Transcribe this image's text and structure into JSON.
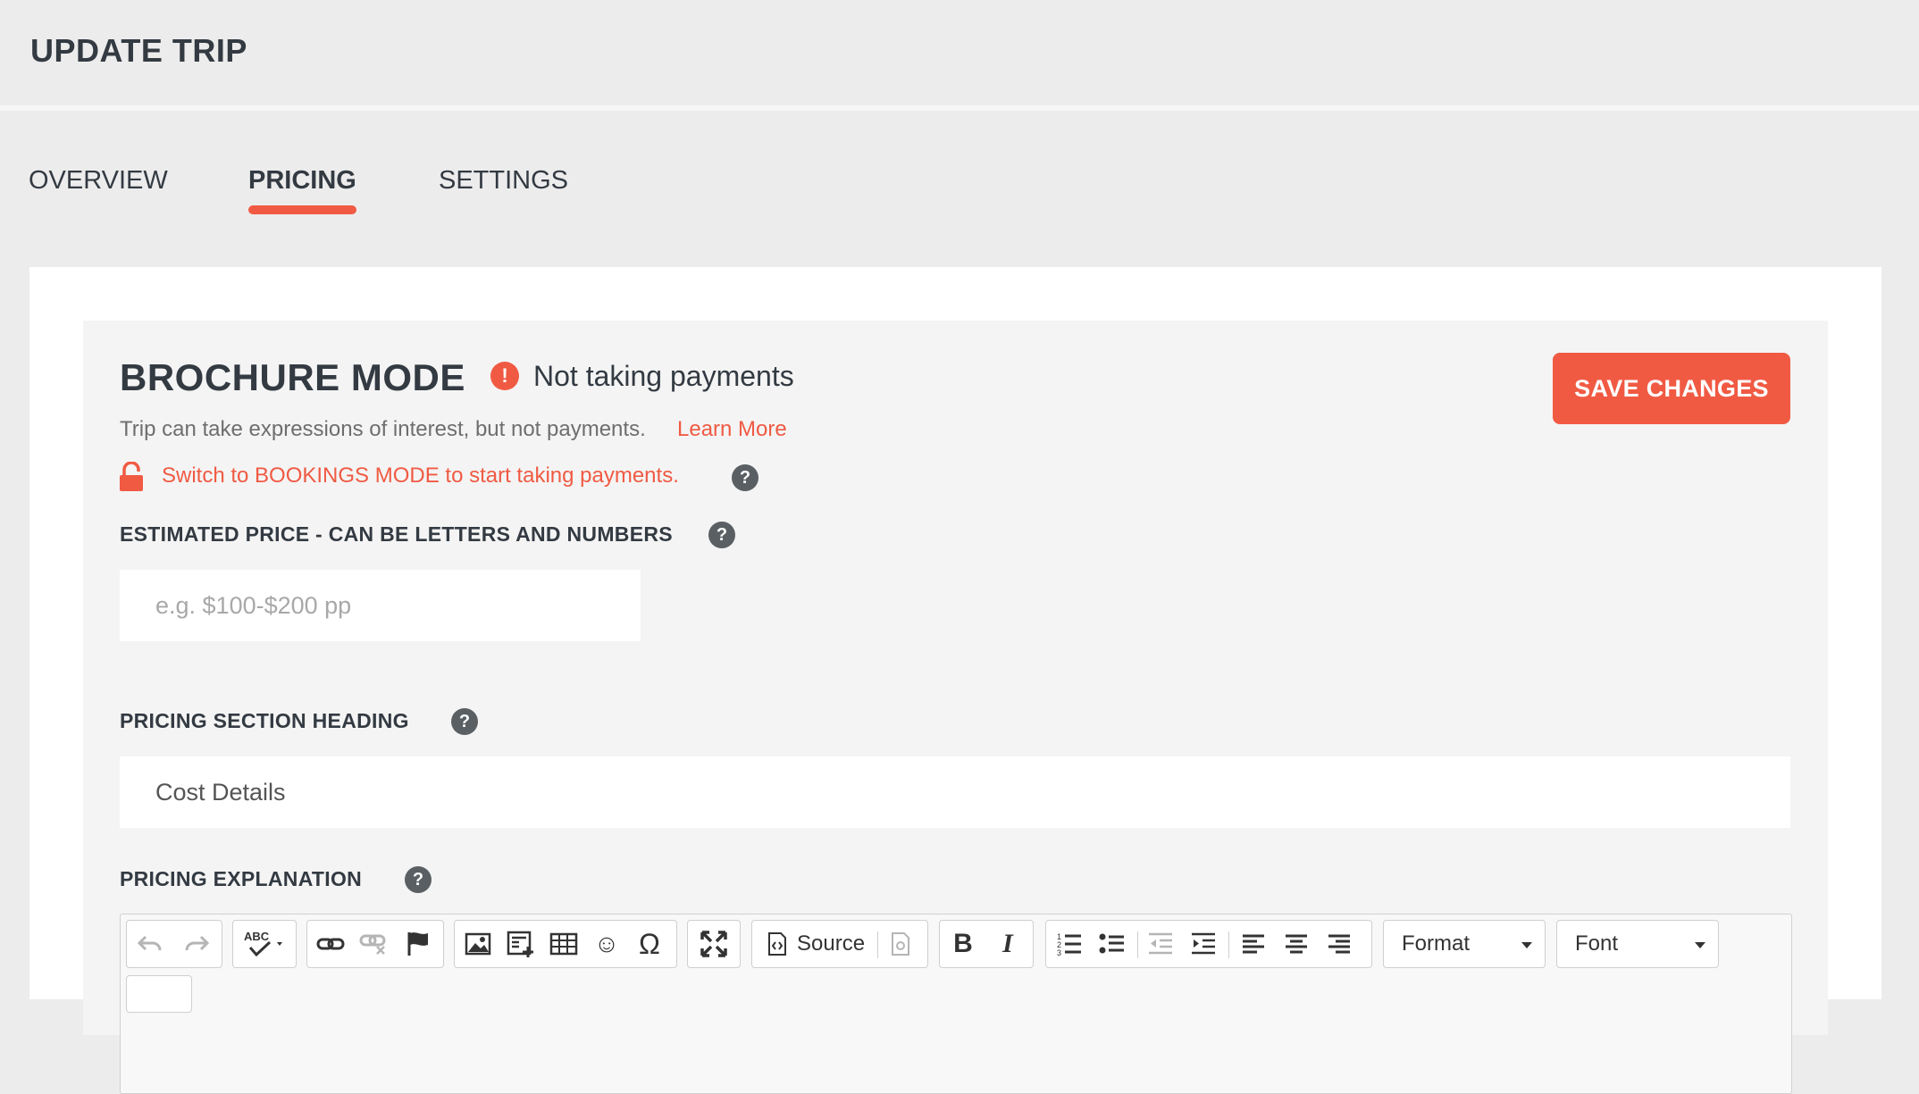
{
  "header": {
    "title": "UPDATE TRIP"
  },
  "tabs": [
    {
      "label": "OVERVIEW",
      "active": false
    },
    {
      "label": "PRICING",
      "active": true
    },
    {
      "label": "SETTINGS",
      "active": false
    }
  ],
  "mode": {
    "title": "BROCHURE MODE",
    "status": "Not taking payments",
    "description": "Trip can take expressions of interest, but not payments.",
    "learn_more": "Learn More",
    "switch_text": "Switch to BOOKINGS MODE to start taking payments."
  },
  "save_button": "SAVE CHANGES",
  "fields": {
    "estimated_price": {
      "label": "ESTIMATED PRICE - CAN BE LETTERS AND NUMBERS",
      "placeholder": "e.g. $100-$200 pp",
      "value": ""
    },
    "pricing_heading": {
      "label": "PRICING SECTION HEADING",
      "value": "Cost Details"
    },
    "pricing_explanation": {
      "label": "PRICING EXPLANATION"
    }
  },
  "help_glyph": "?",
  "warn_glyph": "!",
  "editor": {
    "source_label": "Source",
    "format_label": "Format",
    "font_label": "Font",
    "bold_glyph": "B",
    "italic_glyph": "I",
    "omega_glyph": "Ω",
    "smiley_glyph": "☺"
  },
  "colors": {
    "accent": "#f05a43",
    "text": "#333a42",
    "muted": "#6e6e6e",
    "help_bg": "#595f63"
  }
}
